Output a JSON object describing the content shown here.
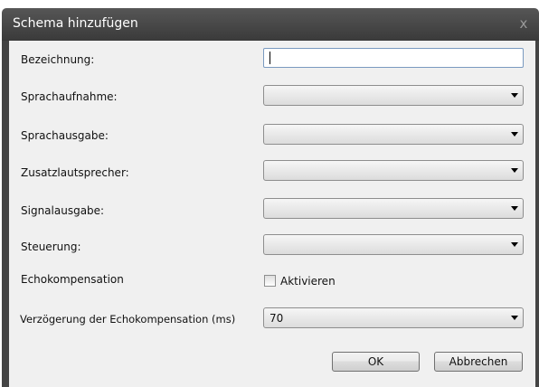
{
  "dialog": {
    "title": "Schema hinzufügen",
    "close_label": "x"
  },
  "form": {
    "name_label": "Bezeichnung:",
    "name_value": "",
    "recording_label": "Sprachaufnahme:",
    "recording_value": "",
    "output_label": "Sprachausgabe:",
    "output_value": "",
    "extra_speaker_label": "Zusatzlautsprecher:",
    "extra_speaker_value": "",
    "signal_output_label": "Signalausgabe:",
    "signal_output_value": "",
    "control_label": "Steuerung:",
    "control_value": "",
    "echo_label": "Echokompensation",
    "echo_checkbox_label": "Aktivieren",
    "echo_checked": false,
    "delay_label": "Verzögerung der Echokompensation  (ms)",
    "delay_value": "70"
  },
  "buttons": {
    "ok_label": "OK",
    "cancel_label": "Abbrechen"
  },
  "icons": {
    "close": "close-icon",
    "dropdown": "chevron-down-icon"
  },
  "colors": {
    "titlebar": "#4a4a4a",
    "client_bg": "#f0f0f0",
    "textbox_border": "#7a9ac0"
  }
}
